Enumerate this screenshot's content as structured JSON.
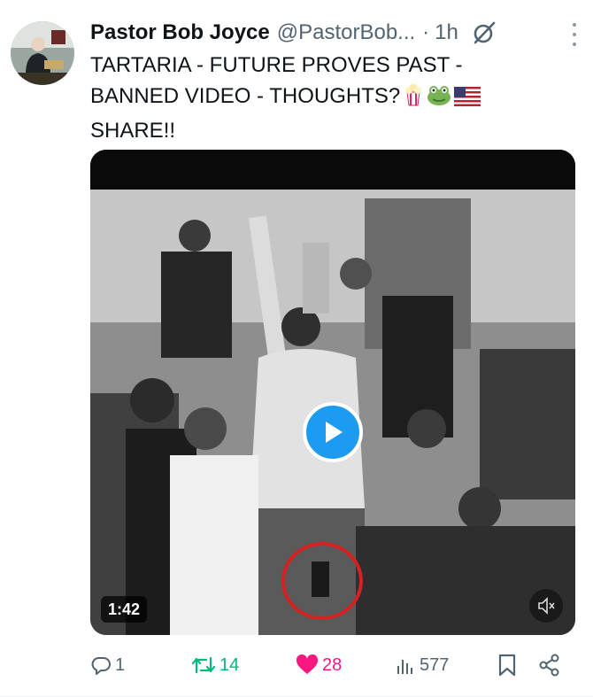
{
  "author": {
    "name": "Pastor Bob Joyce",
    "handle": "@PastorBob...",
    "separator": "·",
    "time": "1h"
  },
  "post": {
    "text_line1": "TARTARIA - FUTURE PROVES PAST -",
    "text_line2": "BANNED VIDEO - THOUGHTS?",
    "text_line3": "SHARE!!",
    "emojis": [
      "popcorn-emoji",
      "frog-emoji",
      "us-flag-emoji"
    ]
  },
  "video": {
    "duration": "1:42"
  },
  "actions": {
    "replies": "1",
    "reposts": "14",
    "likes": "28",
    "views": "577"
  },
  "colors": {
    "text": "#0f1419",
    "secondary": "#536471",
    "repost": "#00ba7c",
    "like": "#f91880",
    "play": "#1d9bf0"
  },
  "icons": [
    "grok-icon",
    "more-icon",
    "play-icon",
    "mute-icon",
    "reply-icon",
    "repost-icon",
    "like-icon",
    "views-icon",
    "bookmark-icon",
    "share-icon"
  ]
}
